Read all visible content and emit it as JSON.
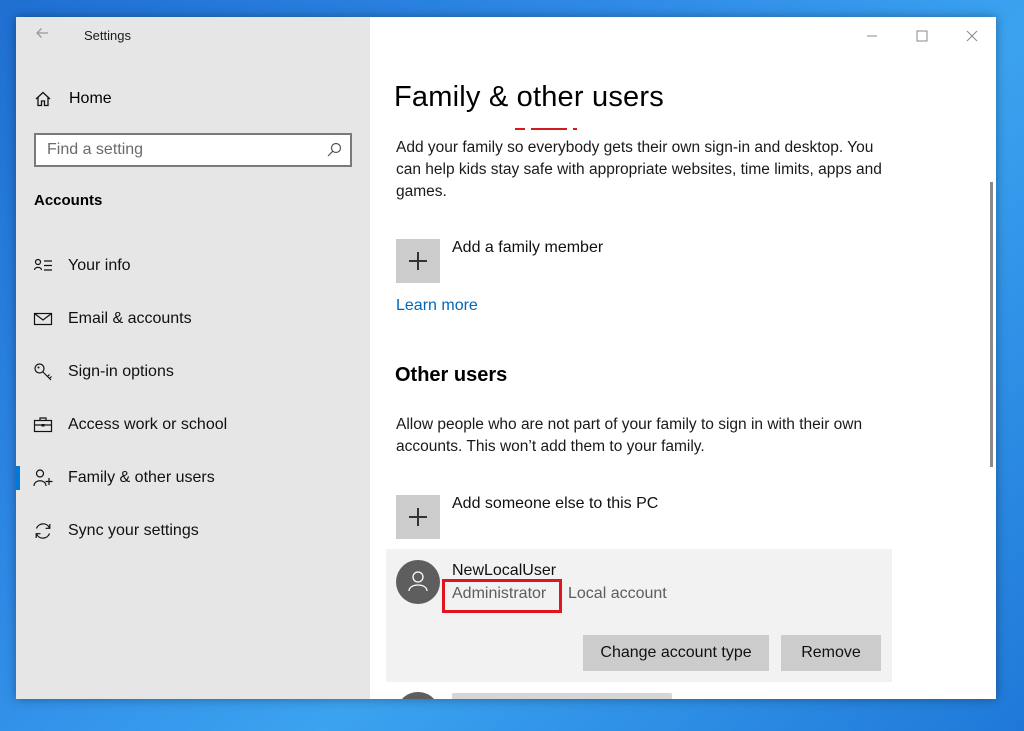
{
  "window": {
    "title": "Settings"
  },
  "sidebar": {
    "home_label": "Home",
    "search_placeholder": "Find a setting",
    "section_label": "Accounts",
    "items": [
      {
        "label": "Your info",
        "icon": "your-info-icon"
      },
      {
        "label": "Email & accounts",
        "icon": "mail-icon"
      },
      {
        "label": "Sign-in options",
        "icon": "key-icon"
      },
      {
        "label": "Access work or school",
        "icon": "briefcase-icon"
      },
      {
        "label": "Family & other users",
        "icon": "add-person-icon",
        "active": true
      },
      {
        "label": "Sync your settings",
        "icon": "sync-icon"
      }
    ]
  },
  "main": {
    "title": "Family & other users",
    "family_description": "Add your family so everybody gets their own sign-in and desktop. You can help kids stay safe with appropriate websites, time limits, apps and games.",
    "add_family_label": "Add a family member",
    "learn_more": "Learn more",
    "other_users_heading": "Other users",
    "other_users_description": "Allow people who are not part of your family to sign in with their own accounts. This won’t add them to your family.",
    "add_someone_label": "Add someone else to this PC",
    "user": {
      "name": "NewLocalUser",
      "role": "Administrator",
      "account_type": "Local account",
      "change_button": "Change account type",
      "remove_button": "Remove"
    }
  },
  "colors": {
    "accent": "#0078d7",
    "link": "#0067b8",
    "highlight_box": "#e0161e",
    "sidebar_bg": "#e6e6e6"
  }
}
